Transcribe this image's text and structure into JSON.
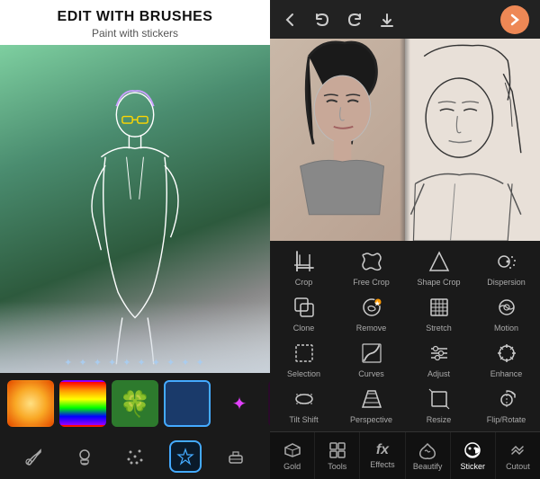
{
  "left": {
    "title": "EDIT WITH BRUSHES",
    "subtitle": "Paint with stickers",
    "stickers": [
      {
        "name": "gold-sparkle",
        "type": "gold"
      },
      {
        "name": "rainbow",
        "type": "rainbow"
      },
      {
        "name": "clover",
        "type": "clover"
      },
      {
        "name": "blue-selected",
        "type": "blue",
        "selected": true
      },
      {
        "name": "sparkle-purple",
        "type": "sparkle"
      },
      {
        "name": "dark-floral",
        "type": "dark"
      }
    ],
    "brush_tools": [
      {
        "id": "paint",
        "label": "paint",
        "icon": "🖌"
      },
      {
        "id": "stamp",
        "label": "stamp",
        "icon": "✦"
      },
      {
        "id": "scatter",
        "label": "scatter",
        "icon": "✶"
      },
      {
        "id": "brush-selected",
        "label": "brush",
        "icon": "⬡",
        "active": true
      },
      {
        "id": "erase",
        "label": "erase",
        "icon": "◻"
      }
    ]
  },
  "right": {
    "nav": {
      "back": "←",
      "undo": "↩",
      "redo": "↪",
      "download": "⬇",
      "forward": "→"
    },
    "tools": [
      {
        "id": "crop",
        "label": "Crop",
        "icon": "crop"
      },
      {
        "id": "free-crop",
        "label": "Free Crop",
        "icon": "free-crop"
      },
      {
        "id": "shape-crop",
        "label": "Shape Crop",
        "icon": "shape-crop"
      },
      {
        "id": "dispersion",
        "label": "Dispersion",
        "icon": "dispersion"
      },
      {
        "id": "clone",
        "label": "Clone",
        "icon": "clone"
      },
      {
        "id": "remove",
        "label": "Remove",
        "icon": "remove",
        "badge": true
      },
      {
        "id": "stretch",
        "label": "Stretch",
        "icon": "stretch"
      },
      {
        "id": "motion",
        "label": "Motion",
        "icon": "motion"
      },
      {
        "id": "selection",
        "label": "Selection",
        "icon": "selection"
      },
      {
        "id": "curves",
        "label": "Curves",
        "icon": "curves"
      },
      {
        "id": "adjust",
        "label": "Adjust",
        "icon": "adjust"
      },
      {
        "id": "enhance",
        "label": "Enhance",
        "icon": "enhance"
      },
      {
        "id": "tilt-shift",
        "label": "Tilt Shift",
        "icon": "tilt-shift"
      },
      {
        "id": "perspective",
        "label": "Perspective",
        "icon": "perspective"
      },
      {
        "id": "resize",
        "label": "Resize",
        "icon": "resize"
      },
      {
        "id": "flip-rotate",
        "label": "Flip/Rotate",
        "icon": "flip-rotate"
      }
    ],
    "bottom_nav": [
      {
        "id": "gold",
        "label": "Gold",
        "icon": "crown"
      },
      {
        "id": "tools",
        "label": "Tools",
        "icon": "tools"
      },
      {
        "id": "effects",
        "label": "Effects",
        "icon": "fx"
      },
      {
        "id": "beautify",
        "label": "Beautify",
        "icon": "beautify"
      },
      {
        "id": "sticker",
        "label": "Sticker",
        "icon": "sticker",
        "active": true
      },
      {
        "id": "cutout",
        "label": "Cutout",
        "icon": "cutout"
      }
    ]
  }
}
